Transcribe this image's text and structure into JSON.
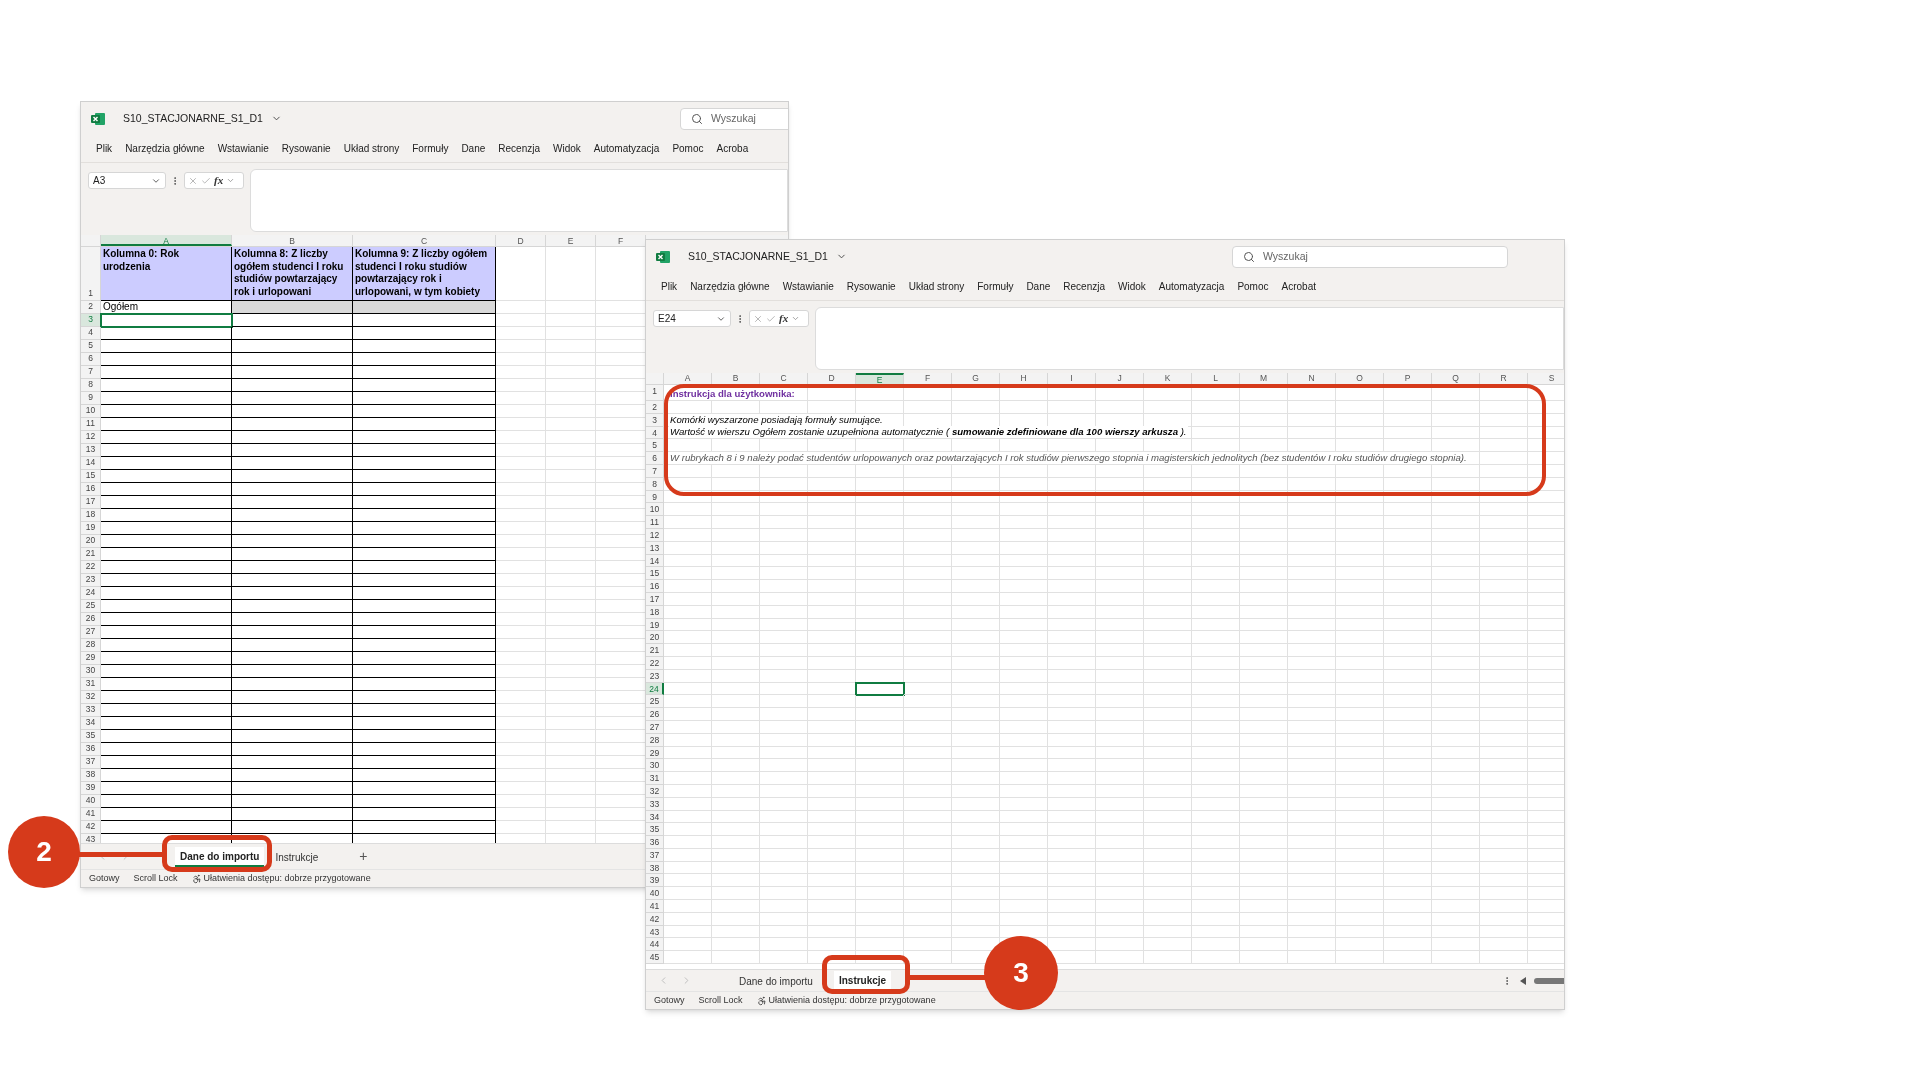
{
  "windows": [
    {
      "kind": "data",
      "title": "S10_STACJONARNE_S1_D1",
      "search_placeholder": "Wyszukaj",
      "menu": [
        "Plik",
        "Narzędzia główne",
        "Wstawianie",
        "Rysowanie",
        "Układ strony",
        "Formuły",
        "Dane",
        "Recenzja",
        "Widok",
        "Automatyzacja",
        "Pomoc",
        "Acroba"
      ],
      "name_box": "A3",
      "fx": "fx",
      "columns": [
        {
          "letter": "A",
          "selected": true
        },
        {
          "letter": "B",
          "selected": false
        },
        {
          "letter": "C",
          "selected": false
        },
        {
          "letter": "D",
          "selected": false
        },
        {
          "letter": "E",
          "selected": false
        },
        {
          "letter": "F",
          "selected": false
        }
      ],
      "table": {
        "headers": [
          "Kolumna 0: Rok urodzenia",
          "Kolumna 8: Z liczby ogółem studenci I roku studiów powtarzający rok i urlopowani",
          "Kolumna 9: Z liczby ogółem studenci I roku studiów powtarzający rok i urlopowani, w tym kobiety"
        ],
        "total_label": "Ogółem"
      },
      "rows": [
        {
          "number": "1",
          "selected": false
        },
        {
          "number": "2",
          "selected": false
        },
        {
          "number": "3",
          "selected": true
        },
        {
          "number": "4",
          "selected": false
        },
        {
          "number": "5",
          "selected": false
        },
        {
          "number": "6",
          "selected": false
        },
        {
          "number": "7",
          "selected": false
        },
        {
          "number": "8",
          "selected": false
        },
        {
          "number": "9",
          "selected": false
        },
        {
          "number": "10",
          "selected": false
        },
        {
          "number": "11",
          "selected": false
        },
        {
          "number": "12",
          "selected": false
        },
        {
          "number": "13",
          "selected": false
        },
        {
          "number": "14",
          "selected": false
        },
        {
          "number": "15",
          "selected": false
        },
        {
          "number": "16",
          "selected": false
        },
        {
          "number": "17",
          "selected": false
        },
        {
          "number": "18",
          "selected": false
        },
        {
          "number": "19",
          "selected": false
        },
        {
          "number": "20",
          "selected": false
        },
        {
          "number": "21",
          "selected": false
        },
        {
          "number": "22",
          "selected": false
        },
        {
          "number": "23",
          "selected": false
        },
        {
          "number": "24",
          "selected": false
        },
        {
          "number": "25",
          "selected": false
        },
        {
          "number": "26",
          "selected": false
        },
        {
          "number": "27",
          "selected": false
        },
        {
          "number": "28",
          "selected": false
        },
        {
          "number": "29",
          "selected": false
        },
        {
          "number": "30",
          "selected": false
        },
        {
          "number": "31",
          "selected": false
        },
        {
          "number": "32",
          "selected": false
        },
        {
          "number": "33",
          "selected": false
        },
        {
          "number": "34",
          "selected": false
        },
        {
          "number": "35",
          "selected": false
        },
        {
          "number": "36",
          "selected": false
        },
        {
          "number": "37",
          "selected": false
        },
        {
          "number": "38",
          "selected": false
        },
        {
          "number": "39",
          "selected": false
        },
        {
          "number": "40",
          "selected": false
        },
        {
          "number": "41",
          "selected": false
        },
        {
          "number": "42",
          "selected": false
        },
        {
          "number": "43",
          "selected": false
        }
      ],
      "sheet_tabs": [
        {
          "label": "Dane do importu",
          "selected": true
        },
        {
          "label": "Instrukcje",
          "selected": false
        }
      ],
      "add_tab": "+",
      "status": [
        "Gotowy",
        "Scroll Lock"
      ],
      "accessibility": "Ułatwienia dostępu: dobrze przygotowane"
    },
    {
      "kind": "instructions",
      "title": "S10_STACJONARNE_S1_D1",
      "search_placeholder": "Wyszukaj",
      "menu": [
        "Plik",
        "Narzędzia główne",
        "Wstawianie",
        "Rysowanie",
        "Układ strony",
        "Formuły",
        "Dane",
        "Recenzja",
        "Widok",
        "Automatyzacja",
        "Pomoc",
        "Acrobat"
      ],
      "name_box": "E24",
      "fx": "fx",
      "columns": [
        {
          "letter": "A",
          "selected": false
        },
        {
          "letter": "B",
          "selected": false
        },
        {
          "letter": "C",
          "selected": false
        },
        {
          "letter": "D",
          "selected": false
        },
        {
          "letter": "E",
          "selected": true
        },
        {
          "letter": "F",
          "selected": false
        },
        {
          "letter": "G",
          "selected": false
        },
        {
          "letter": "H",
          "selected": false
        },
        {
          "letter": "I",
          "selected": false
        },
        {
          "letter": "J",
          "selected": false
        },
        {
          "letter": "K",
          "selected": false
        },
        {
          "letter": "L",
          "selected": false
        },
        {
          "letter": "M",
          "selected": false
        },
        {
          "letter": "N",
          "selected": false
        },
        {
          "letter": "O",
          "selected": false
        },
        {
          "letter": "P",
          "selected": false
        },
        {
          "letter": "Q",
          "selected": false
        },
        {
          "letter": "R",
          "selected": false
        },
        {
          "letter": "S",
          "selected": false
        }
      ],
      "rows": [
        {
          "number": "1",
          "selected": false,
          "text": "Instrukcja dla użytkownika:",
          "kind": "heading"
        },
        {
          "number": "2",
          "selected": false
        },
        {
          "number": "3",
          "selected": false,
          "text": "Komórki wyszarzone posiadają formuły sumujące.",
          "kind": "italic"
        },
        {
          "number": "4",
          "selected": false,
          "text": "Wartość w wierszu Ogółem zostanie uzupełniona automatycznie ( **sumowanie zdefiniowane dla 100 wierszy arkusza** ).",
          "kind": "italic"
        },
        {
          "number": "5",
          "selected": false
        },
        {
          "number": "6",
          "selected": false,
          "text": "W rubrykach 8 i 9 należy podać studentów urlopowanych oraz powtarzających I rok studiów pierwszego stopnia i magisterskich jednolitych (bez studentów I roku studiów drugiego stopnia).",
          "kind": "note"
        },
        {
          "number": "7",
          "selected": false
        },
        {
          "number": "8",
          "selected": false
        },
        {
          "number": "9",
          "selected": false
        },
        {
          "number": "10",
          "selected": false
        },
        {
          "number": "11",
          "selected": false
        },
        {
          "number": "12",
          "selected": false
        },
        {
          "number": "13",
          "selected": false
        },
        {
          "number": "14",
          "selected": false
        },
        {
          "number": "15",
          "selected": false
        },
        {
          "number": "16",
          "selected": false
        },
        {
          "number": "17",
          "selected": false
        },
        {
          "number": "18",
          "selected": false
        },
        {
          "number": "19",
          "selected": false
        },
        {
          "number": "20",
          "selected": false
        },
        {
          "number": "21",
          "selected": false
        },
        {
          "number": "22",
          "selected": false
        },
        {
          "number": "23",
          "selected": false
        },
        {
          "number": "24",
          "selected": true
        },
        {
          "number": "25",
          "selected": false
        },
        {
          "number": "26",
          "selected": false
        },
        {
          "number": "27",
          "selected": false
        },
        {
          "number": "28",
          "selected": false
        },
        {
          "number": "29",
          "selected": false
        },
        {
          "number": "30",
          "selected": false
        },
        {
          "number": "31",
          "selected": false
        },
        {
          "number": "32",
          "selected": false
        },
        {
          "number": "33",
          "selected": false
        },
        {
          "number": "34",
          "selected": false
        },
        {
          "number": "35",
          "selected": false
        },
        {
          "number": "36",
          "selected": false
        },
        {
          "number": "37",
          "selected": false
        },
        {
          "number": "38",
          "selected": false
        },
        {
          "number": "39",
          "selected": false
        },
        {
          "number": "40",
          "selected": false
        },
        {
          "number": "41",
          "selected": false
        },
        {
          "number": "42",
          "selected": false
        },
        {
          "number": "43",
          "selected": false
        },
        {
          "number": "44",
          "selected": false
        },
        {
          "number": "45",
          "selected": false
        }
      ],
      "sheet_tabs": [
        {
          "label": "Dane do importu",
          "selected": false
        },
        {
          "label": "Instrukcje",
          "selected": true
        }
      ],
      "status": [
        "Gotowy",
        "Scroll Lock"
      ],
      "accessibility": "Ułatwienia dostępu: dobrze przygotowane"
    }
  ],
  "callouts": [
    {
      "number": "2"
    },
    {
      "number": "3"
    }
  ]
}
